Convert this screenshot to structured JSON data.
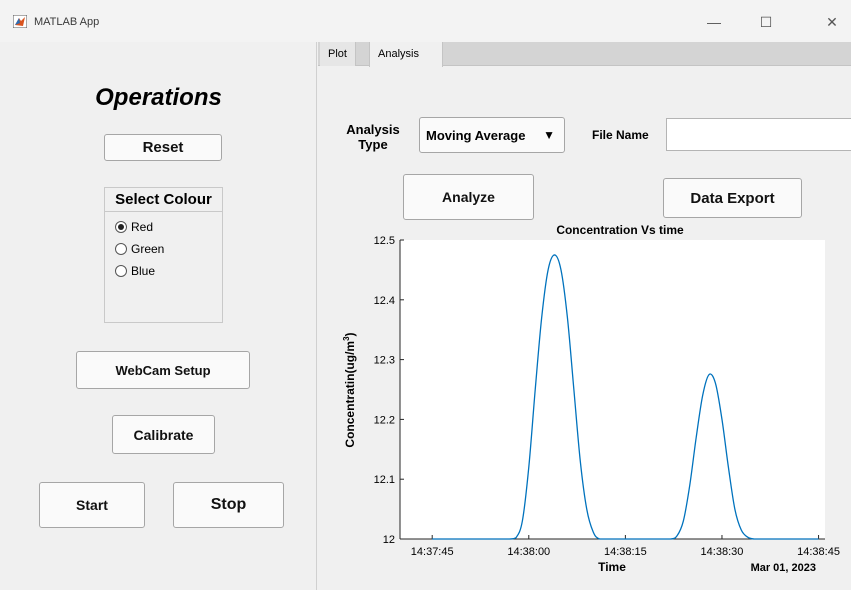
{
  "window": {
    "title": "MATLAB App",
    "minimize_glyph": "—",
    "maximize_glyph": "☐",
    "close_glyph": "✕",
    "app_icon": "matlab-logo-icon"
  },
  "left": {
    "heading": "Operations",
    "reset_label": "Reset",
    "colour_group": {
      "title": "Select Colour",
      "options": [
        {
          "label": "Red",
          "checked": true
        },
        {
          "label": "Green",
          "checked": false
        },
        {
          "label": "Blue",
          "checked": false
        }
      ]
    },
    "webcam_label": "WebCam Setup",
    "calibrate_label": "Calibrate",
    "start_label": "Start",
    "stop_label": "Stop"
  },
  "tabs": [
    {
      "label": "Plot",
      "active": false
    },
    {
      "label": "Analysis",
      "active": true
    }
  ],
  "analysis": {
    "type_label_line1": "Analysis",
    "type_label_line2": "Type",
    "type_value": "Moving Average",
    "dropdown_arrow": "▼",
    "file_name_label": "File Name",
    "file_name_value": "",
    "analyze_label": "Analyze",
    "export_label": "Data Export"
  },
  "colors": {
    "line": "#0072bd",
    "axes_bg": "#ffffff",
    "panel_bg": "#f0f0f0"
  },
  "chart_data": {
    "type": "line",
    "title": "Concentration Vs time",
    "xlabel": "Time",
    "ylabel_main": "Concentratin(ug/m",
    "ylabel_sup": "3",
    "ylabel_close": ")",
    "date_label": "Mar 01, 2023",
    "x_tick_labels": [
      "14:37:45",
      "14:38:00",
      "14:38:15",
      "14:38:30",
      "14:38:45"
    ],
    "x_tick_seconds": [
      45,
      60,
      75,
      90,
      105
    ],
    "xlim_seconds": [
      40,
      106
    ],
    "ylim": [
      12,
      12.5
    ],
    "y_tick_labels": [
      "12",
      "12.1",
      "12.2",
      "12.3",
      "12.4",
      "12.5"
    ],
    "y_ticks": [
      12,
      12.1,
      12.2,
      12.3,
      12.4,
      12.5
    ],
    "series": [
      {
        "x_seconds": [
          45,
          50,
          55,
          57,
          58,
          59,
          60,
          61,
          62,
          63,
          64,
          65,
          66,
          67,
          68,
          69,
          70,
          71,
          73,
          76,
          80,
          82,
          83,
          84,
          85,
          86,
          87,
          88,
          89,
          90,
          91,
          92,
          93,
          94,
          95,
          97,
          100,
          105
        ],
        "values": [
          12.0,
          12.0,
          12.0,
          12.0,
          12.002,
          12.03,
          12.12,
          12.25,
          12.37,
          12.45,
          12.475,
          12.45,
          12.37,
          12.25,
          12.13,
          12.05,
          12.012,
          12.0,
          12.0,
          12.0,
          12.0,
          12.0,
          12.005,
          12.03,
          12.09,
          12.17,
          12.24,
          12.275,
          12.26,
          12.2,
          12.12,
          12.05,
          12.015,
          12.003,
          12.0,
          12.0,
          12.0,
          12.0
        ]
      }
    ]
  }
}
